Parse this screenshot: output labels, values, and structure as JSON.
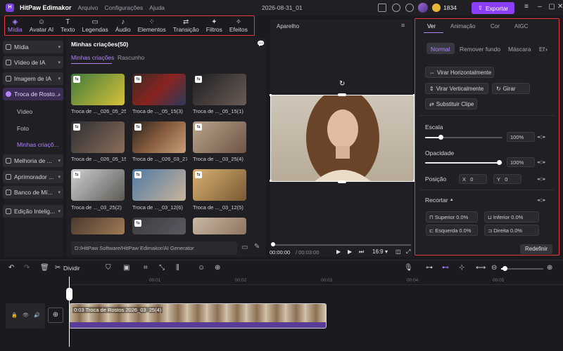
{
  "app": {
    "name": "HitPaw Edimakor",
    "menu": [
      "Arquivo",
      "Configurações",
      "Ajuda"
    ],
    "doc_title": "2026-08-31_01",
    "credits": "1834",
    "export_label": "Exportar"
  },
  "toolbar": [
    {
      "label": "Mídia",
      "icon": "media-icon",
      "active": true
    },
    {
      "label": "Avatar AI",
      "icon": "avatar-icon"
    },
    {
      "label": "Texto",
      "icon": "text-icon"
    },
    {
      "label": "Legendas",
      "icon": "subtitle-icon"
    },
    {
      "label": "Áudio",
      "icon": "audio-icon"
    },
    {
      "label": "Elementos",
      "icon": "elements-icon"
    },
    {
      "label": "Transição",
      "icon": "transition-icon"
    },
    {
      "label": "Filtros",
      "icon": "filter-icon"
    },
    {
      "label": "Efeitos",
      "icon": "effects-icon"
    }
  ],
  "sidebar": {
    "items": [
      "Mídia",
      "Vídeo de IA",
      "Imagem de IA",
      "Troca de Rosto...",
      "Melhoria de ...",
      "Aprimorador ...",
      "Banco de Mí...",
      "Edição Intelig..."
    ],
    "subitems": [
      "Vídeo",
      "Foto",
      "Minhas criaçõ..."
    ]
  },
  "media": {
    "title": "Minhas criações(50)",
    "tabs": [
      "Minhas criações",
      "Rascunho"
    ],
    "items": [
      "Troca de ..._026_05_25",
      "Troca de ..._05_15(3)",
      "Troca de ..._05_15(1)",
      "Troca de ..._026_05_15",
      "Troca de ..._026_03_27",
      "Troca de ..._03_25(4)",
      "Troca de ..._03_25(2)",
      "Troca de ..._03_12(6)",
      "Troca de ..._03_12(5)",
      "",
      "",
      ""
    ],
    "path": "D:/HitPaw Software/HitPaw Edimakor/AI Generator"
  },
  "player": {
    "title": "Aparelho",
    "current_time": "00:00:00",
    "total_time": "/ 00:03:00",
    "ratio": "16:9"
  },
  "props": {
    "tabs": [
      "Ver",
      "Animação",
      "Cor",
      "AIGC"
    ],
    "subtabs": [
      "Normal",
      "Remover fundo",
      "Máscara",
      "Ef"
    ],
    "buttons": [
      "Virar Horizontalmente",
      "Virar Verticalmente",
      "Girar",
      "Substituir Clipe"
    ],
    "scale": {
      "label": "Escala",
      "value": "100%"
    },
    "opacity": {
      "label": "Opacidade",
      "value": "100%"
    },
    "position": {
      "label": "Posição",
      "x_label": "X",
      "x": "0",
      "y_label": "Y",
      "y": "0"
    },
    "crop": {
      "label": "Recortar",
      "top": "Superior",
      "top_v": "0.0%",
      "bottom": "Inferior",
      "bottom_v": "0.0%",
      "left": "Esquerda",
      "left_v": "0.0%",
      "right": "Direita",
      "right_v": "0.0%"
    },
    "reset": "Redefinir"
  },
  "timeline": {
    "split_label": "Dividir",
    "ruler": [
      "00:01",
      "00:02",
      "00:03",
      "00:04",
      "00:05"
    ],
    "clip_label": "0:03 Troca de Rostos 2026_03_25(4)"
  }
}
